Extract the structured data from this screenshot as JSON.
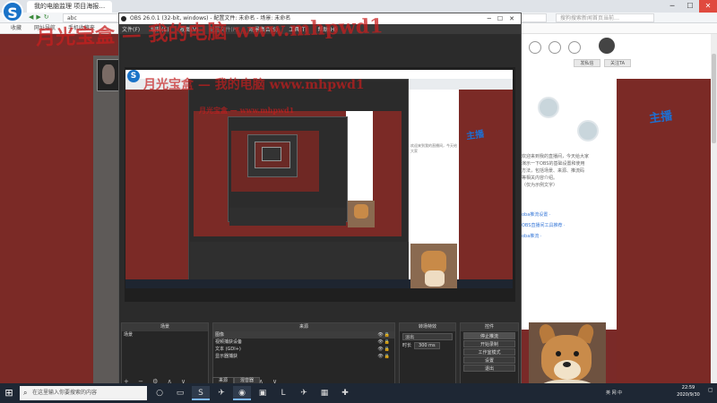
{
  "browser": {
    "tab_title": "我的电脑监理 项目海报…",
    "address": "abc",
    "search_placeholder": "搜狗搜索新闻首页当前…",
    "bookmarks": [
      "收藏",
      "网址导航",
      "手机收藏夹"
    ],
    "window_controls": [
      "─",
      "☐",
      "✕"
    ]
  },
  "watermark": {
    "main": "月光宝盒 — 我的电脑 www.mhpwd1",
    "mid": "月光宝盒 — 我的电脑 www.mhpwd1",
    "small": "月光宝盒 — www.mhpwd1"
  },
  "obs": {
    "title": "OBS 26.0.1 (32-bit, windows) - 配置文件: 未命名 - 场景: 未命名",
    "menu": [
      "文件(F)",
      "编辑(E)",
      "视图(V)",
      "配置文件(P)",
      "场景集合(S)",
      "工具(T)",
      "帮助(H)"
    ],
    "docks": {
      "scenes_title": "场景",
      "sources_title": "来源",
      "transitions_title": "转场特效",
      "controls_title": "控件"
    },
    "scenes": [
      "场景"
    ],
    "sources": [
      {
        "name": "图像",
        "selected": true
      },
      {
        "name": "视频捕获设备",
        "selected": false
      },
      {
        "name": "文本 (GDI+)",
        "selected": false
      },
      {
        "name": "显示器捕获",
        "selected": false
      }
    ],
    "transition": {
      "selected": "淡出",
      "duration_label": "时长",
      "duration_value": "300 ms"
    },
    "controls": [
      "停止推流",
      "开始录制",
      "工作室模式",
      "设置",
      "退出"
    ],
    "tabs": [
      "来源",
      "混音器"
    ],
    "toolbar_symbols": "+ − ⚙ ∧ ∨"
  },
  "right_panel": {
    "buttons": [
      "发私信",
      "关注TA"
    ],
    "text_lines": [
      "欢迎来到我的直播间，今天给大家",
      "演示一下OBS的基础设置和使用",
      "方法，包括场景、来源、推流码",
      "等相关内容介绍。",
      "（仅为示例文字）"
    ],
    "links": [
      "oba推流设置 ·",
      "OBS直播间工具推荐 ·",
      "oba推流 ·"
    ],
    "sticker": "主播"
  },
  "taskbar": {
    "search_placeholder": "在这里输入你要搜索的内容",
    "clock_time": "22:59",
    "clock_date": "2020/9/30",
    "tray_label": "英 网 中"
  }
}
